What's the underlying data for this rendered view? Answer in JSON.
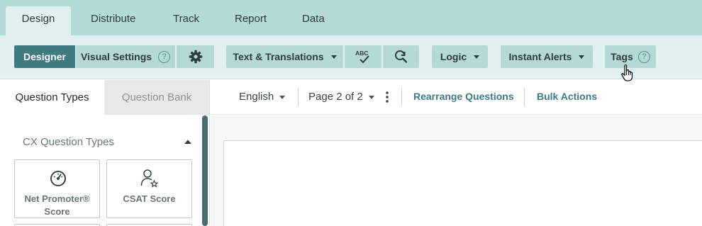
{
  "top_tabs": [
    "Design",
    "Distribute",
    "Track",
    "Report",
    "Data"
  ],
  "toolbar": {
    "designer": "Designer",
    "visual_settings": "Visual Settings",
    "text_translations": "Text & Translations",
    "spellcheck_glyph": "ABC",
    "logic": "Logic",
    "instant_alerts": "Instant Alerts",
    "tags": "Tags",
    "help_glyph": "?"
  },
  "left_panel": {
    "tabs": [
      "Question Types",
      "Question Bank"
    ],
    "section_title": "CX Question Types",
    "cards": [
      {
        "label_line1": "Net Promoter®",
        "label_line2": "Score",
        "icon": "speedometer-icon"
      },
      {
        "label_line1": "CSAT Score",
        "label_line2": "",
        "icon": "person-star-icon"
      }
    ]
  },
  "survey_bar": {
    "language": "English",
    "page": "Page 2 of 2",
    "rearrange": "Rearrange Questions",
    "bulk": "Bulk Actions"
  },
  "colors": {
    "accent": "#3f7a81",
    "tab_bar": "#b4dada",
    "toolbar_bg": "#e1f0f0",
    "button_bg": "#b4d9d6"
  }
}
